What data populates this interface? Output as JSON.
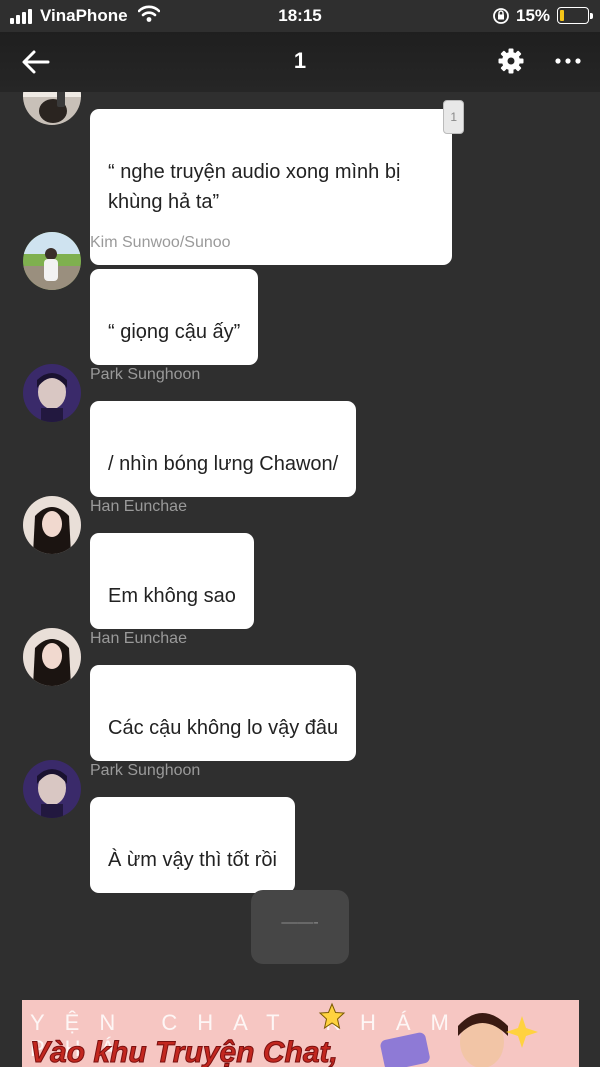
{
  "status_bar": {
    "carrier": "VinaPhone",
    "time": "18:15",
    "battery_percent": "15%",
    "battery_level": 0.15,
    "battery_color": "#f5c518"
  },
  "header": {
    "title": "1",
    "back_icon": "arrow-left-icon",
    "settings_icon": "gear-icon",
    "more_icon": "more-horizontal-icon"
  },
  "messages": [
    {
      "sender": "",
      "text": "“ nghe truyện audio xong mình bị\nkhùng hả ta”",
      "reply_count": "1"
    },
    {
      "sender": "Kim Sunwoo/Sunoo",
      "text": "“ giọng cậu ấy”"
    },
    {
      "sender": "Park Sunghoon",
      "text": "/ nhìn bóng lưng Chawon/"
    },
    {
      "sender": "Han Eunchae",
      "text": "Em không sao"
    },
    {
      "sender": "Han Eunchae",
      "text": "Các cậu không lo vậy đâu"
    },
    {
      "sender": "Park Sunghoon",
      "text": "À ừm vậy thì tốt rồi"
    }
  ],
  "typing_indicator": {
    "text": "——-"
  },
  "banner": {
    "top_text": "YỆN CHAT KHÁM PHÁ",
    "main_text": "Vào khu Truyện Chat,"
  }
}
